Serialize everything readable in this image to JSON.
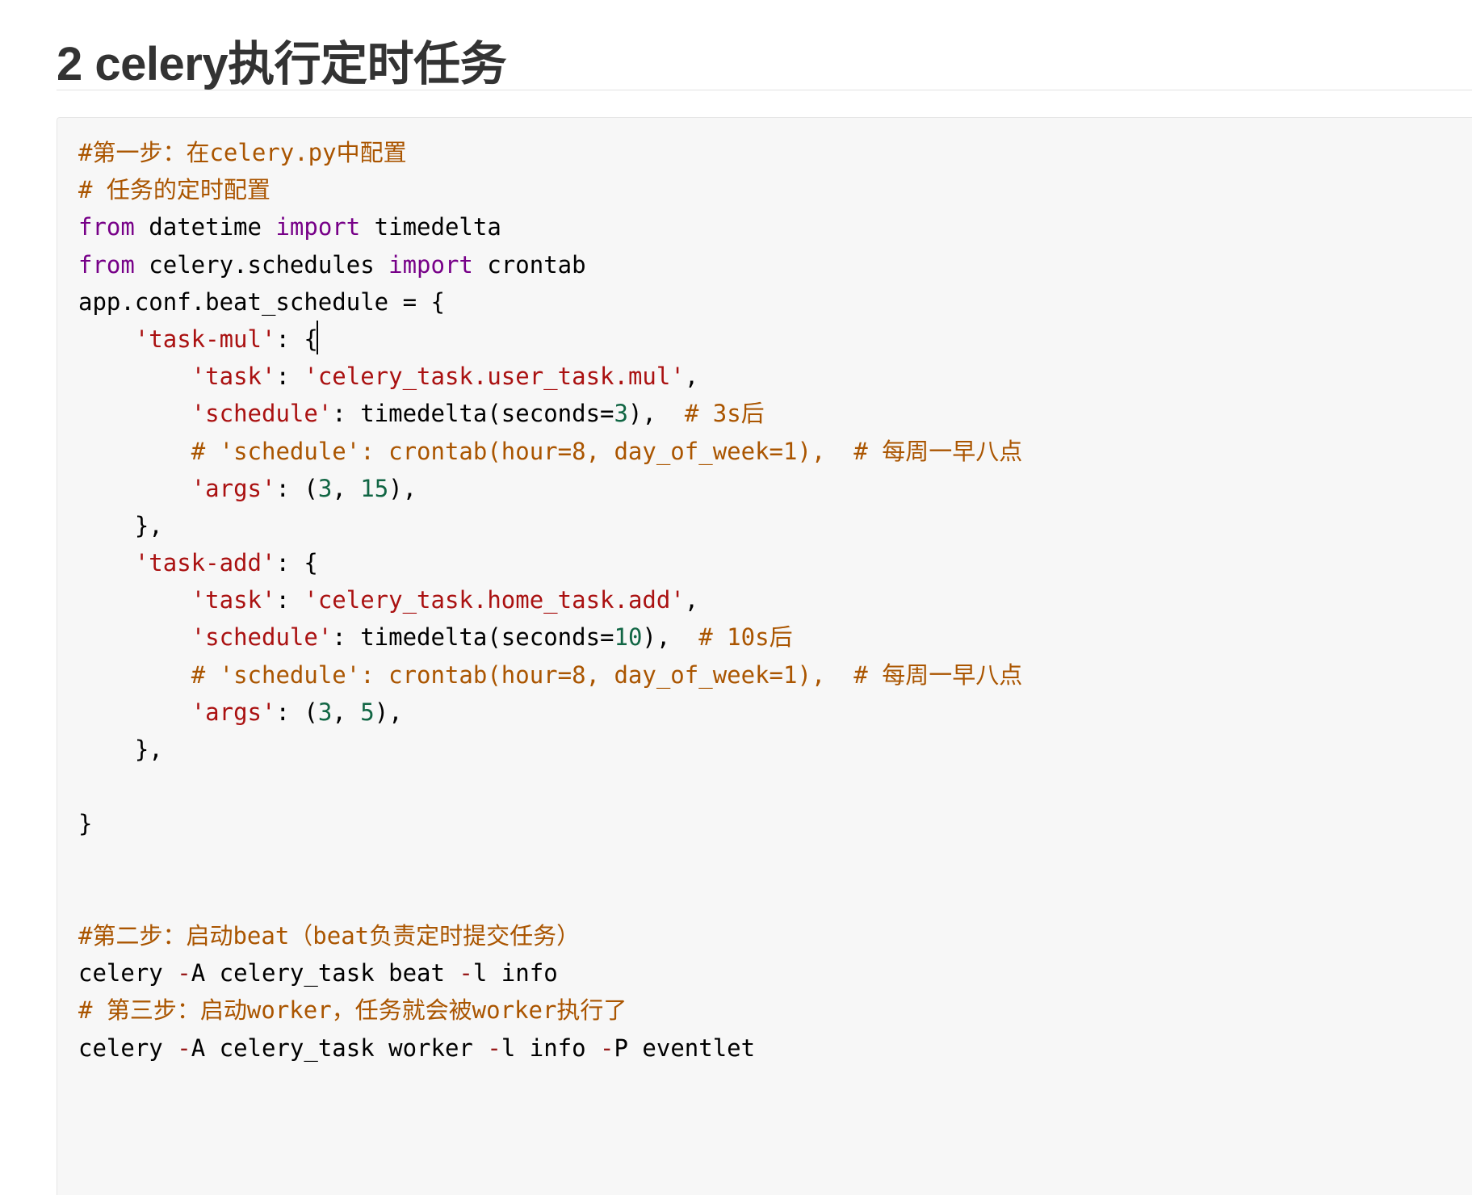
{
  "heading": "2 celery执行定时任务",
  "code": {
    "language": "python",
    "colors": {
      "comment": "#aa5500",
      "keyword": "#770088",
      "string": "#aa1111",
      "number": "#116644",
      "operator": "#981a1a",
      "default": "#000000",
      "background": "#f7f7f7"
    },
    "lines": [
      [
        {
          "t": "cm",
          "v": "#第一步：在celery.py中配置"
        }
      ],
      [
        {
          "t": "cm",
          "v": "# 任务的定时配置"
        }
      ],
      [
        {
          "t": "kw",
          "v": "from"
        },
        {
          "t": "df",
          "v": " datetime "
        },
        {
          "t": "kw",
          "v": "import"
        },
        {
          "t": "df",
          "v": " timedelta"
        }
      ],
      [
        {
          "t": "kw",
          "v": "from"
        },
        {
          "t": "df",
          "v": " celery.schedules "
        },
        {
          "t": "kw",
          "v": "import"
        },
        {
          "t": "df",
          "v": " crontab"
        }
      ],
      [
        {
          "t": "df",
          "v": "app.conf.beat_schedule = {"
        }
      ],
      [
        {
          "t": "df",
          "v": "    "
        },
        {
          "t": "st",
          "v": "'task-mul'"
        },
        {
          "t": "df",
          "v": ": {"
        },
        {
          "t": "cursor",
          "v": ""
        }
      ],
      [
        {
          "t": "df",
          "v": "        "
        },
        {
          "t": "st",
          "v": "'task'"
        },
        {
          "t": "df",
          "v": ": "
        },
        {
          "t": "st",
          "v": "'celery_task.user_task.mul'"
        },
        {
          "t": "df",
          "v": ","
        }
      ],
      [
        {
          "t": "df",
          "v": "        "
        },
        {
          "t": "st",
          "v": "'schedule'"
        },
        {
          "t": "df",
          "v": ": timedelta(seconds="
        },
        {
          "t": "nu",
          "v": "3"
        },
        {
          "t": "df",
          "v": "),  "
        },
        {
          "t": "cm",
          "v": "# 3s后"
        }
      ],
      [
        {
          "t": "df",
          "v": "        "
        },
        {
          "t": "cm",
          "v": "# 'schedule': crontab(hour=8, day_of_week=1),  # 每周一早八点"
        }
      ],
      [
        {
          "t": "df",
          "v": "        "
        },
        {
          "t": "st",
          "v": "'args'"
        },
        {
          "t": "df",
          "v": ": ("
        },
        {
          "t": "nu",
          "v": "3"
        },
        {
          "t": "df",
          "v": ", "
        },
        {
          "t": "nu",
          "v": "15"
        },
        {
          "t": "df",
          "v": "),"
        }
      ],
      [
        {
          "t": "df",
          "v": "    },"
        }
      ],
      [
        {
          "t": "df",
          "v": "    "
        },
        {
          "t": "st",
          "v": "'task-add'"
        },
        {
          "t": "df",
          "v": ": {"
        }
      ],
      [
        {
          "t": "df",
          "v": "        "
        },
        {
          "t": "st",
          "v": "'task'"
        },
        {
          "t": "df",
          "v": ": "
        },
        {
          "t": "st",
          "v": "'celery_task.home_task.add'"
        },
        {
          "t": "df",
          "v": ","
        }
      ],
      [
        {
          "t": "df",
          "v": "        "
        },
        {
          "t": "st",
          "v": "'schedule'"
        },
        {
          "t": "df",
          "v": ": timedelta(seconds="
        },
        {
          "t": "nu",
          "v": "10"
        },
        {
          "t": "df",
          "v": "),  "
        },
        {
          "t": "cm",
          "v": "# 10s后"
        }
      ],
      [
        {
          "t": "df",
          "v": "        "
        },
        {
          "t": "cm",
          "v": "# 'schedule': crontab(hour=8, day_of_week=1),  # 每周一早八点"
        }
      ],
      [
        {
          "t": "df",
          "v": "        "
        },
        {
          "t": "st",
          "v": "'args'"
        },
        {
          "t": "df",
          "v": ": ("
        },
        {
          "t": "nu",
          "v": "3"
        },
        {
          "t": "df",
          "v": ", "
        },
        {
          "t": "nu",
          "v": "5"
        },
        {
          "t": "df",
          "v": "),"
        }
      ],
      [
        {
          "t": "df",
          "v": "    },"
        }
      ],
      [],
      [
        {
          "t": "df",
          "v": "}"
        }
      ],
      [],
      [],
      [
        {
          "t": "cm",
          "v": "#第二步：启动beat（beat负责定时提交任务）"
        }
      ],
      [
        {
          "t": "df",
          "v": "celery "
        },
        {
          "t": "op",
          "v": "-"
        },
        {
          "t": "df",
          "v": "A celery_task beat "
        },
        {
          "t": "op",
          "v": "-"
        },
        {
          "t": "df",
          "v": "l info"
        }
      ],
      [
        {
          "t": "cm",
          "v": "# 第三步：启动worker，任务就会被worker执行了"
        }
      ],
      [
        {
          "t": "df",
          "v": "celery "
        },
        {
          "t": "op",
          "v": "-"
        },
        {
          "t": "df",
          "v": "A celery_task worker "
        },
        {
          "t": "op",
          "v": "-"
        },
        {
          "t": "df",
          "v": "l info "
        },
        {
          "t": "op",
          "v": "-"
        },
        {
          "t": "df",
          "v": "P eventlet"
        }
      ]
    ]
  }
}
